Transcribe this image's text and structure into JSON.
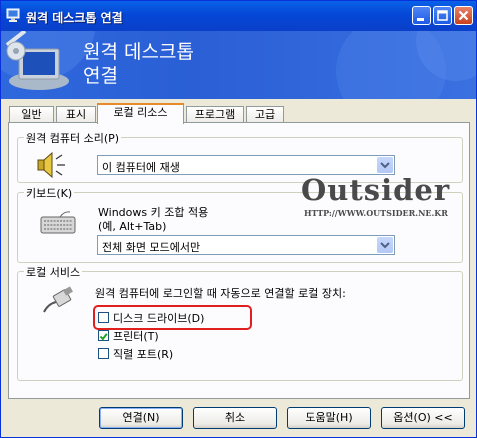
{
  "window": {
    "title": "원격 데스크톱 연결",
    "banner_line1": "원격 데스크톱",
    "banner_line2": "연결"
  },
  "tabs": [
    {
      "label": "일반",
      "active": false
    },
    {
      "label": "표시",
      "active": false
    },
    {
      "label": "로컬 리소스",
      "active": true
    },
    {
      "label": "프로그램",
      "active": false
    },
    {
      "label": "고급",
      "active": false
    }
  ],
  "sound": {
    "group_label": "원격 컴퓨터 소리(P)",
    "selected": "이 컴퓨터에 재생"
  },
  "keyboard": {
    "group_label": "키보드(K)",
    "line1": "Windows 키 조합 적용",
    "line2": "(예, Alt+Tab)",
    "selected": "전체 화면 모드에서만"
  },
  "devices": {
    "group_label": "로컬 서비스",
    "description": "원격 컴퓨터에 로그인할 때 자동으로 연결할 로컬 장치:",
    "items": [
      {
        "label": "디스크 드라이브(D)",
        "checked": false
      },
      {
        "label": "프린터(T)",
        "checked": true
      },
      {
        "label": "직렬 포트(R)",
        "checked": false
      }
    ]
  },
  "buttons": {
    "connect": "연결(N)",
    "cancel": "취소",
    "help": "도움말(H)",
    "options": "옵션(O) <<"
  },
  "watermark": {
    "name": "Outsider",
    "url": "HTTP://WWW.OUTSIDER.NE.KR"
  },
  "colors": {
    "titlebar": "#0a4fd8",
    "highlight": "#e02020",
    "active_tab_accent": "#e68b2c"
  }
}
